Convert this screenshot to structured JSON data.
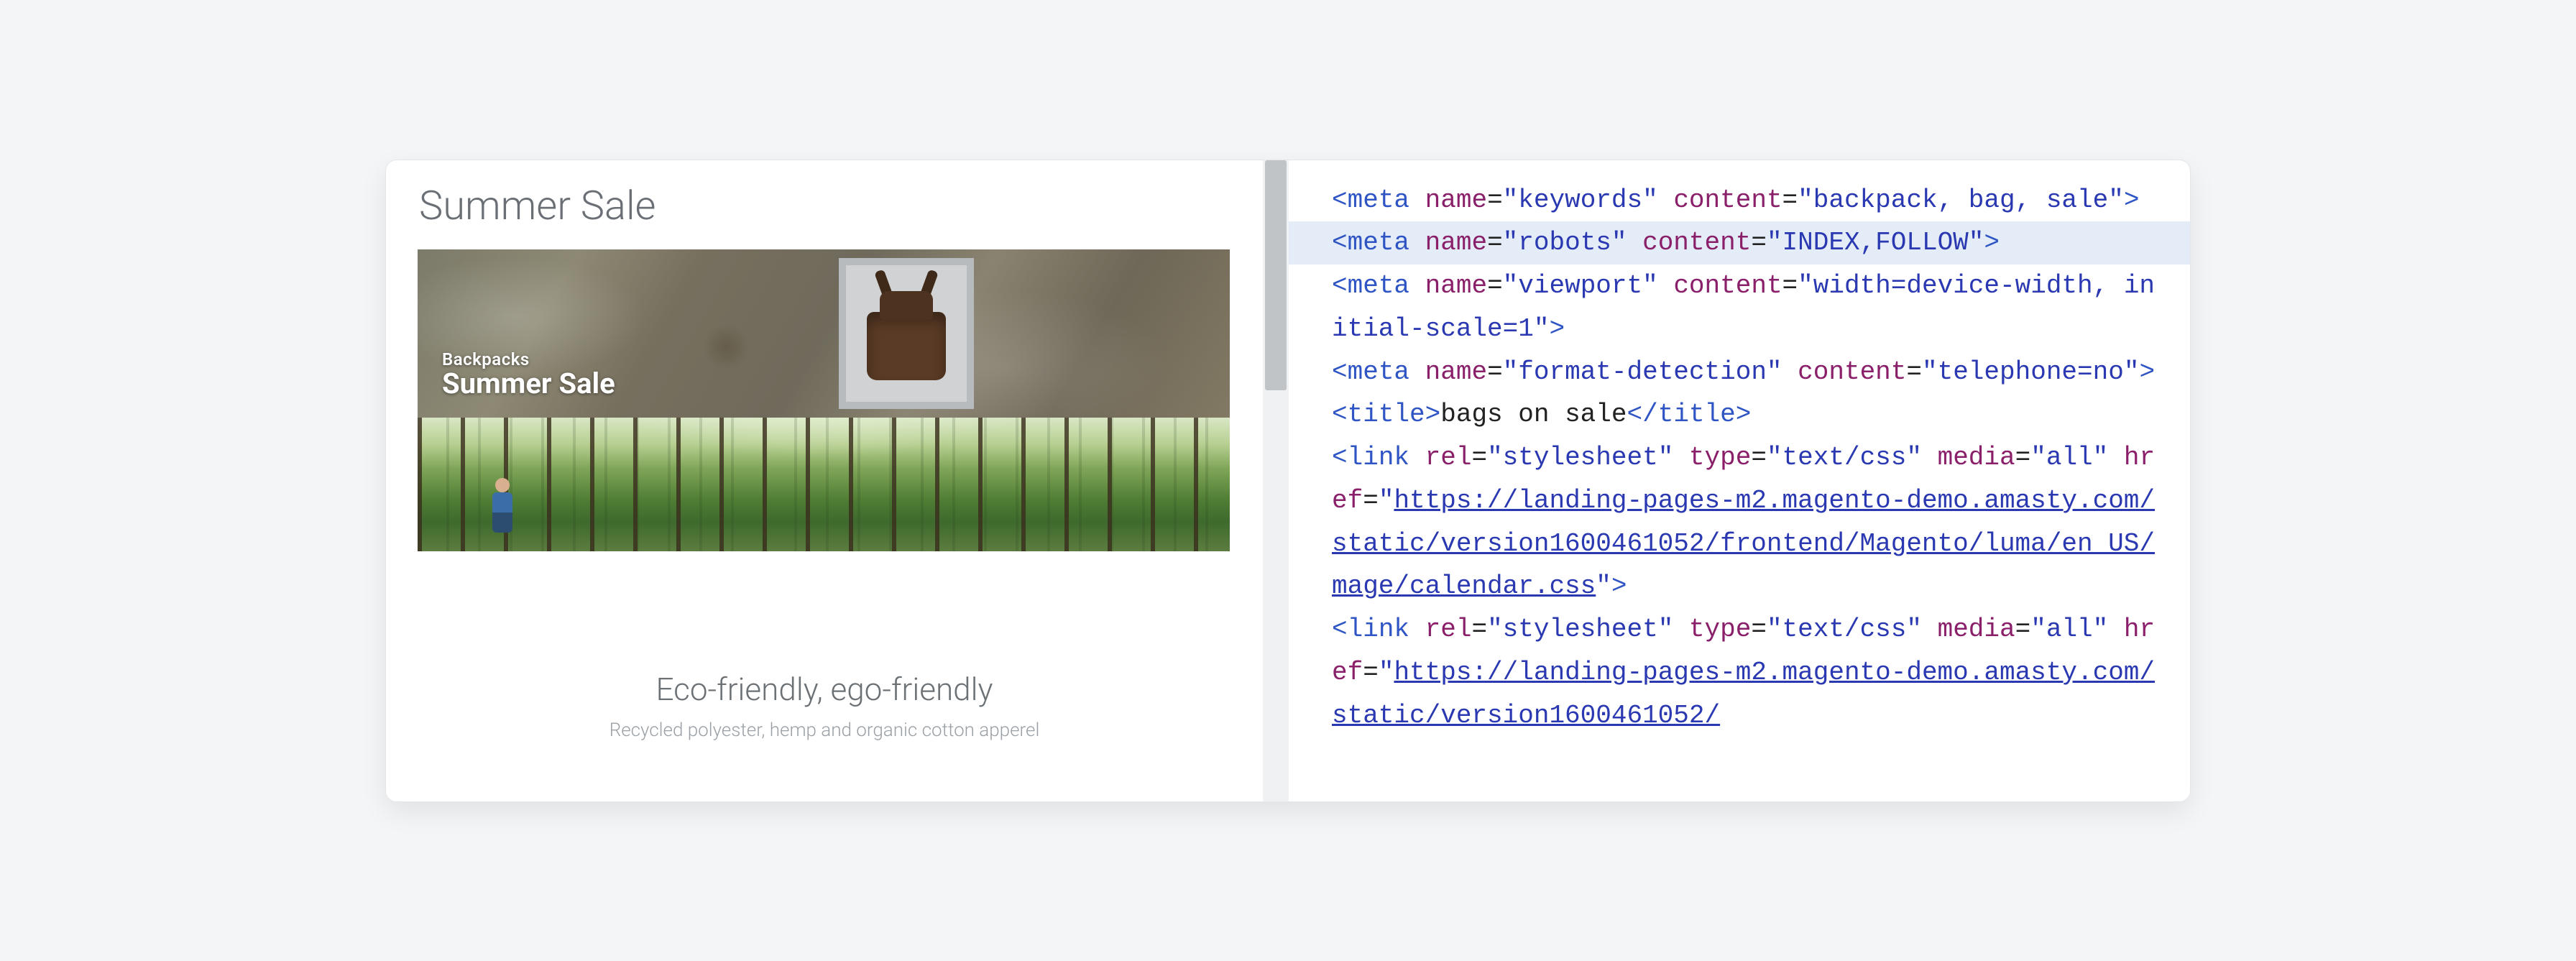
{
  "preview": {
    "page_title": "Summer Sale",
    "banner1_sub": "Backpacks",
    "banner1_head": "Summer Sale",
    "copy_heading": "Eco-friendly, ego-friendly",
    "copy_sub": "Recycled polyester, hemp and organic cotton apperel"
  },
  "code": {
    "l1a": "<",
    "l1b": "meta",
    "l1c": " name",
    "l1d": "=",
    "l1e": "\"keywords\"",
    "l1f": " content",
    "l1g": "=",
    "l1h": "\"backpack, bag, sale\"",
    "l1i": ">",
    "l2a": "<",
    "l2b": "meta",
    "l2c": " name",
    "l2d": "=",
    "l2e": "\"robots\"",
    "l2f": " content",
    "l2g": "=",
    "l2h": "\"INDEX,FOLLOW\"",
    "l2i": ">",
    "l3a": "<",
    "l3b": "meta",
    "l3c": " name",
    "l3d": "=",
    "l3e": "\"viewport\"",
    "l3f": " content",
    "l3g": "=",
    "l3h": "\"width=device-width, initial-scale=1\"",
    "l3i": ">",
    "l4a": "<",
    "l4b": "meta",
    "l4c": " name",
    "l4d": "=",
    "l4e": "\"format-detection\"",
    "l4f": " content",
    "l4g": "=",
    "l4h": "\"telephone=no\"",
    "l4i": ">",
    "l5a": "<",
    "l5b": "title",
    "l5c": ">",
    "l5d": "bags on sale",
    "l5e": "</",
    "l5f": "title",
    "l5g": ">",
    "l6a": "<",
    "l6b": "link",
    "l6c": " rel",
    "l6d": "=",
    "l6e": "\"stylesheet\"",
    "l6f": " type",
    "l6g": "=",
    "l6h": "\"text/css\"",
    "l6i": " media",
    "l6j": "=",
    "l6k": "\"all\"",
    "l6l": " href",
    "l6m": "=",
    "l6n": "\"",
    "l6o": "https://landing-pages-m2.magento-demo.amasty.com/static/version1600461052/frontend/Magento/luma/en_US/mage/calendar.css",
    "l6p": "\"",
    "l6q": ">",
    "l7a": "<",
    "l7b": "link",
    "l7c": " rel",
    "l7d": "=",
    "l7e": "\"stylesheet\"",
    "l7f": " type",
    "l7g": "=",
    "l7h": "\"text/css\"",
    "l7i": " media",
    "l7j": "=",
    "l7k": "\"all\"",
    "l7l": " href",
    "l7m": "=",
    "l7n": "\"",
    "l7o": "https://landing-pages-m2.magento-demo.amasty.com/static/version1600461052/"
  }
}
